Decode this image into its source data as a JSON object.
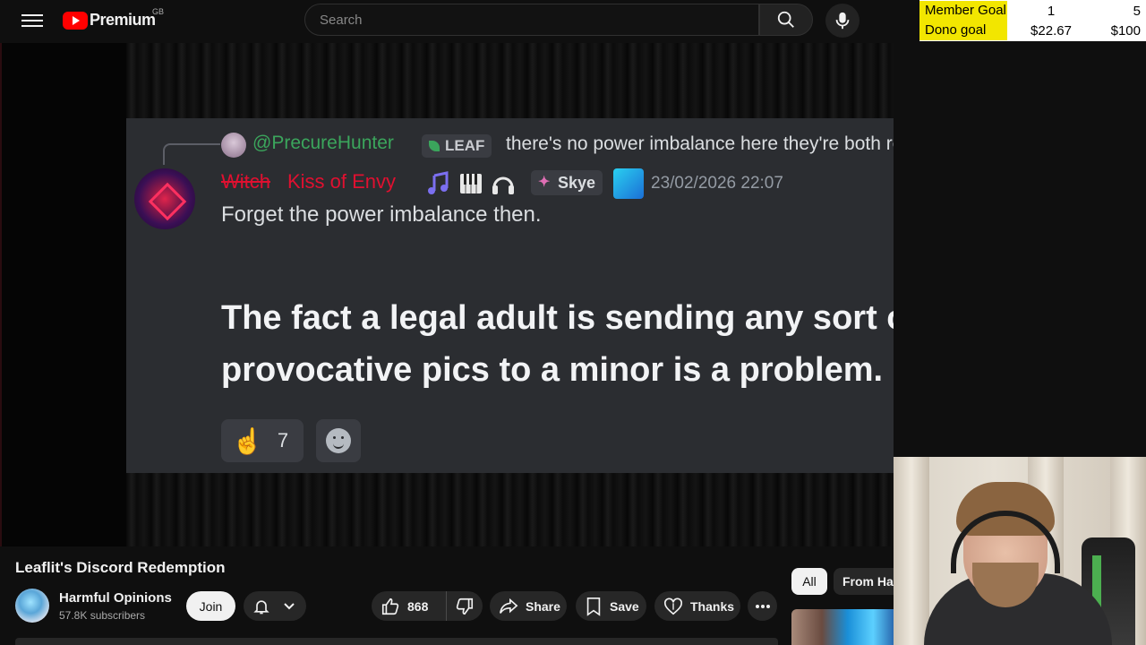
{
  "header": {
    "logo_text": "Premium",
    "region": "GB",
    "search_placeholder": "Search"
  },
  "overlay_goals": {
    "member_label": "Member Goal",
    "member_current": "1",
    "member_target": "5",
    "dono_label": "Dono goal",
    "dono_current": "$22.67",
    "dono_target": "$100"
  },
  "discord_message": {
    "reply_user": "@PrecureHunter",
    "reply_tag": "LEAF",
    "reply_text": "there's no power imbalance here they're both retarded",
    "author_prefix_struck": "Witch",
    "author_name": "Kiss of Envy",
    "role_label": "Skye",
    "timestamp": "23/02/2026 22:07",
    "line1": "Forget the power imbalance then.",
    "emphasis": "The fact a legal adult is sending any sort of provocative pics to a minor is a problem.",
    "reaction_count": "7"
  },
  "video": {
    "title": "Leaflit's Discord Redemption",
    "channel_name": "Harmful Opinions",
    "subscribers": "57.8K subscribers",
    "join_label": "Join",
    "likes": "868",
    "share_label": "Share",
    "save_label": "Save",
    "thanks_label": "Thanks"
  },
  "sidebar": {
    "chip_all": "All",
    "chip_from": "From Har"
  }
}
